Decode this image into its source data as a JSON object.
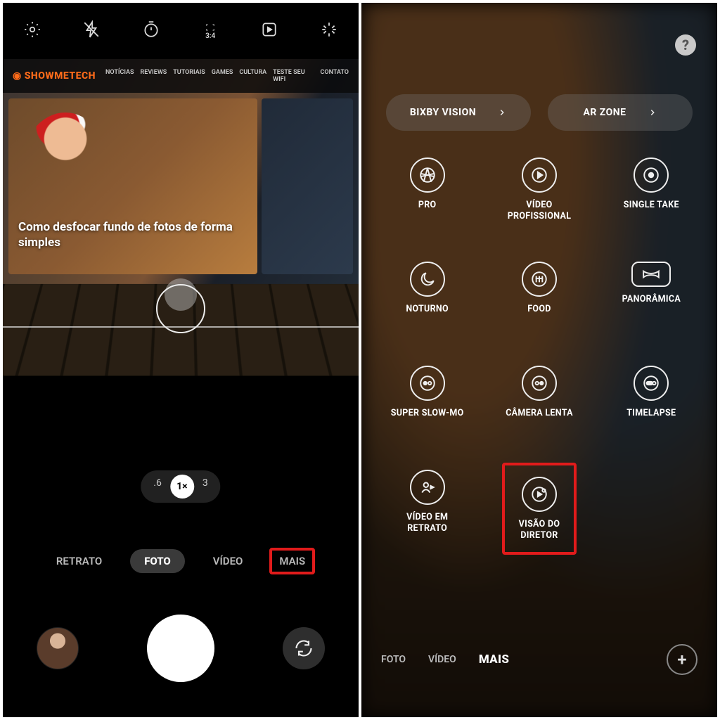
{
  "left": {
    "topbar_icons": [
      "settings-icon",
      "flash-off-icon",
      "timer-icon",
      "aspect-3-4-icon",
      "motion-photo-icon",
      "filters-icon"
    ],
    "aspect_label": "3:4",
    "site_logo": "SHOWMETECH",
    "site_nav": [
      "NOTÍCIAS",
      "REVIEWS",
      "TUTORIAIS",
      "GAMES",
      "CULTURA",
      "TESTE SEU WIFI",
      "CONTATO"
    ],
    "card_title": "Como desfocar fundo de fotos de forma simples",
    "zoom_levels": {
      "wide": ".6",
      "selected": "1×",
      "tele": "3"
    },
    "modes": {
      "items": [
        "RETRATO",
        "FOTO",
        "VÍDEO",
        "MAIS"
      ],
      "selected": "FOTO",
      "highlighted": "MAIS"
    },
    "highlight_color": "#e11b1b"
  },
  "right": {
    "pills": {
      "left": "BIXBY VISION",
      "right": "AR ZONE"
    },
    "grid": [
      {
        "icon": "aperture-icon",
        "label": "PRO"
      },
      {
        "icon": "video-pro-icon",
        "label": "VÍDEO\nPROFISSIONAL"
      },
      {
        "icon": "record-dot-icon",
        "label": "SINGLE TAKE"
      },
      {
        "icon": "moon-icon",
        "label": "NOTURNO"
      },
      {
        "icon": "food-icon",
        "label": "FOOD"
      },
      {
        "icon": "panorama-icon",
        "label": "PANORÂMICA"
      },
      {
        "icon": "slowmo-icon",
        "label": "SUPER SLOW-MO"
      },
      {
        "icon": "slowmo-icon",
        "label": "CÂMERA LENTA"
      },
      {
        "icon": "timelapse-icon",
        "label": "TIMELAPSE"
      },
      {
        "icon": "portrait-vid-icon",
        "label": "VÍDEO EM\nRETRATO"
      },
      {
        "icon": "director-icon",
        "label": "VISÃO DO\nDIRETOR",
        "highlighted": true
      }
    ],
    "footer": {
      "items": [
        "FOTO",
        "VÍDEO",
        "MAIS"
      ],
      "selected": "MAIS"
    }
  }
}
